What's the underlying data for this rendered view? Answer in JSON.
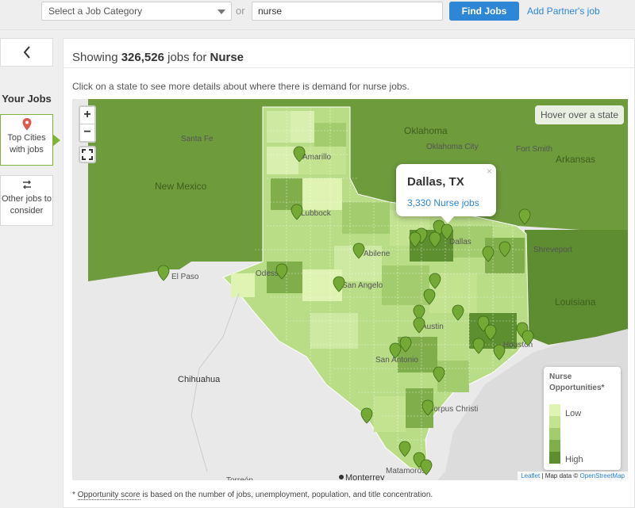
{
  "search": {
    "category_placeholder": "Select a Job Category",
    "or_label": "or",
    "query_value": "nurse",
    "find_button": "Find Jobs",
    "partner_link": "Add Partner's job"
  },
  "sidebar": {
    "back_icon": "chevron-left-icon",
    "heading": "Your Jobs",
    "items": [
      {
        "icon": "map-pin-icon",
        "label": "Top Cities with jobs",
        "active": true
      },
      {
        "icon": "swap-arrows-icon",
        "label": "Other jobs to consider",
        "active": false
      }
    ]
  },
  "results": {
    "prefix": "Showing",
    "count": "326,526",
    "middle": "jobs for",
    "query": "Nurse",
    "hint": "Click on a state to see more details about where there is demand for nurse jobs."
  },
  "map": {
    "zoom_in": "+",
    "zoom_out": "−",
    "hover_hint": "Hover over a state",
    "popup": {
      "city": "Dallas, TX",
      "jobs": "3,330 Nurse jobs",
      "close": "×"
    },
    "labels": [
      "Santa Fe",
      "New Mexico",
      "Oklahoma",
      "Oklahoma City",
      "Fort Smith",
      "Arkansas",
      "Amarillo",
      "Lubbock",
      "Abilene",
      "Odessa",
      "El Paso",
      "San Angelo",
      "Dallas",
      "Austin",
      "San Antonio",
      "Houston",
      "Shreveport",
      "Louisiana",
      "Corpus Christi",
      "Chihuahua",
      "Monterrey",
      "Matamoros",
      "Torreón"
    ],
    "legend": {
      "title_line1": "Nurse",
      "title_line2": "Opportunities*",
      "low": "Low",
      "high": "High",
      "colors": [
        "#dff3b2",
        "#c3e391",
        "#a3cc6e",
        "#7fae4b",
        "#5d8e30"
      ]
    },
    "attribution": {
      "leaflet": "Leaflet",
      "mapdata": "Map data ©",
      "osm": "OpenStreetMap"
    },
    "colors": {
      "land": "#e8e8e8",
      "neighbor_state": "#6e9b3c",
      "texas_base": "#b9dc87",
      "water": "#b8d8e8",
      "pin": "#73a934"
    }
  },
  "footnote": {
    "star": "*",
    "link": "Opportunity score",
    "text": "is based on the number of jobs, unemployment, population, and title concentration."
  }
}
